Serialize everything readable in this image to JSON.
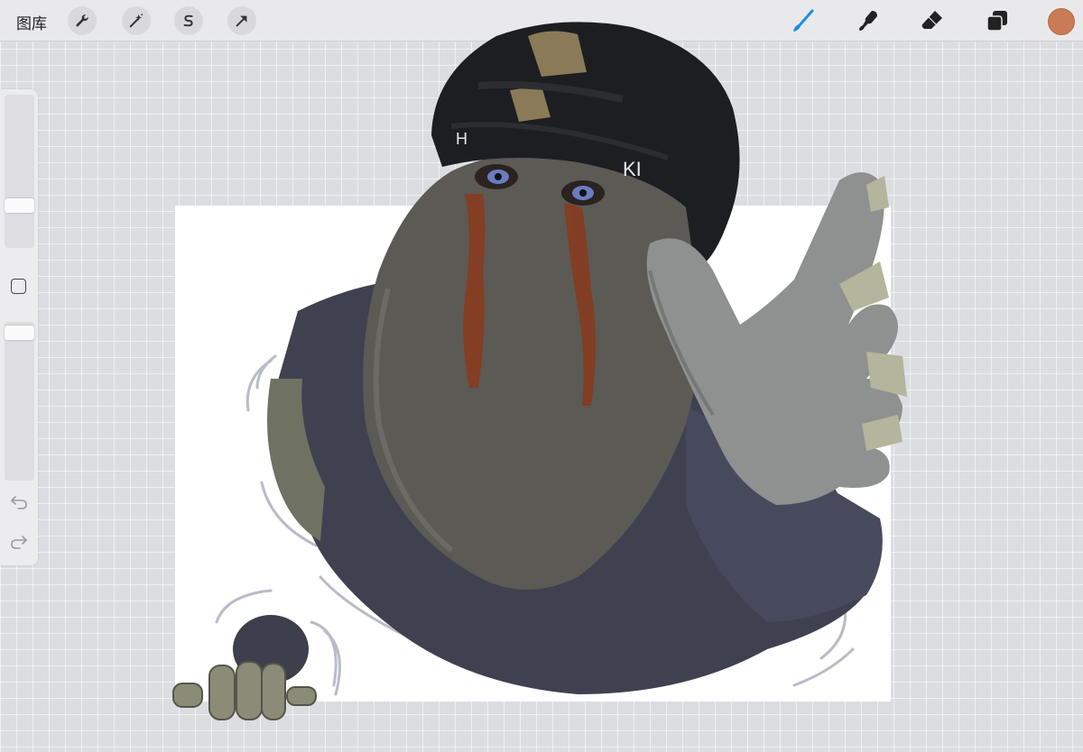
{
  "topbar": {
    "gallery_label": "图库",
    "left_tools": [
      {
        "name": "actions",
        "icon": "wrench-icon"
      },
      {
        "name": "adjustments",
        "icon": "magic-wand-icon"
      },
      {
        "name": "selection",
        "icon": "selection-s-icon"
      },
      {
        "name": "transform",
        "icon": "arrow-cursor-icon"
      }
    ],
    "right_tools": [
      {
        "name": "brush",
        "icon": "brush-icon",
        "active": true
      },
      {
        "name": "smudge",
        "icon": "smudge-icon"
      },
      {
        "name": "eraser",
        "icon": "eraser-icon"
      },
      {
        "name": "layers",
        "icon": "layers-icon"
      }
    ],
    "current_color": "#c87b54",
    "accent": "#1a8fe0"
  },
  "sidebar": {
    "brush_size_level": 0.65,
    "opacity_level": 0.0,
    "modify_icon": "square-icon",
    "undo_icon": "undo-icon",
    "redo_icon": "redo-icon"
  },
  "canvas": {
    "background": "#ffffff"
  }
}
